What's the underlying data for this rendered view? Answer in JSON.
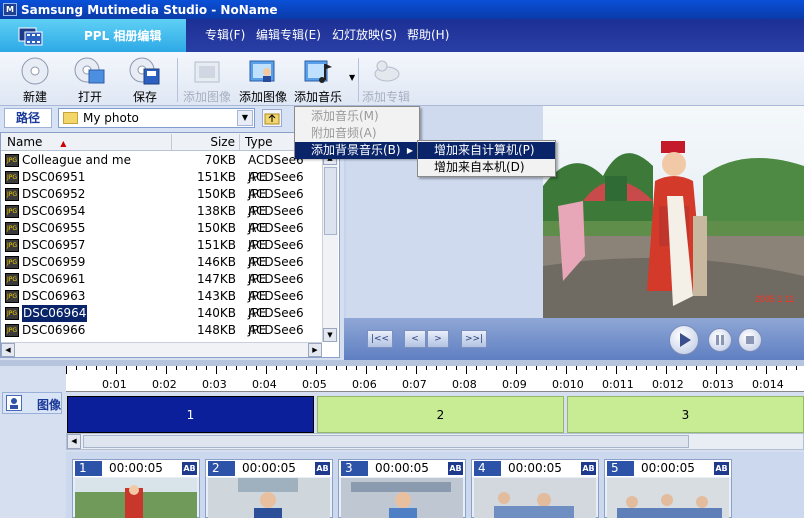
{
  "window": {
    "title": "Samsung Mutimedia Studio - NoName"
  },
  "header": {
    "tab_label": "PPL 相册编辑"
  },
  "menu": [
    {
      "label": "专辑(F)"
    },
    {
      "label": "编辑专辑(E)"
    },
    {
      "label": "幻灯放映(S)"
    },
    {
      "label": "帮助(H)"
    }
  ],
  "toolbar": {
    "new": "新建",
    "open": "打开",
    "save": "保存",
    "add_image_disabled": "添加图像",
    "add_image": "添加图像",
    "add_music": "添加音乐",
    "add_album": "添加专辑"
  },
  "path": {
    "label": "路径",
    "value": "My photo"
  },
  "filelist": {
    "columns": {
      "name": "Name",
      "size": "Size",
      "type": "Type"
    },
    "rows": [
      {
        "name": "Colleague and me",
        "size": "70KB",
        "type": "ACDSee6 JPE"
      },
      {
        "name": "DSC06951",
        "size": "151KB",
        "type": "ACDSee6 JPE"
      },
      {
        "name": "DSC06952",
        "size": "150KB",
        "type": "ACDSee6 JPE"
      },
      {
        "name": "DSC06954",
        "size": "138KB",
        "type": "ACDSee6 JPE"
      },
      {
        "name": "DSC06955",
        "size": "150KB",
        "type": "ACDSee6 JPE"
      },
      {
        "name": "DSC06957",
        "size": "151KB",
        "type": "ACDSee6 JPE"
      },
      {
        "name": "DSC06959",
        "size": "146KB",
        "type": "ACDSee6 JPE"
      },
      {
        "name": "DSC06961",
        "size": "147KB",
        "type": "ACDSee6 JPE"
      },
      {
        "name": "DSC06963",
        "size": "143KB",
        "type": "ACDSee6 JPE"
      },
      {
        "name": "DSC06964",
        "size": "140KB",
        "type": "ACDSee6 JPE"
      },
      {
        "name": "DSC06966",
        "size": "148KB",
        "type": "ACDSee6 JPE"
      }
    ],
    "selected_index": 9
  },
  "context_menu": {
    "items": [
      {
        "label": "添加音乐(M)"
      },
      {
        "label": "附加音频(A)"
      },
      {
        "label": "添加背景音乐(B)"
      }
    ],
    "submenu": [
      {
        "label": "增加来自计算机(P)"
      },
      {
        "label": "增加来自本机(D)"
      }
    ]
  },
  "preview": {
    "photo_stamp": "2005 1 11"
  },
  "controls": {
    "first": "|<<",
    "prev": "<",
    "next": ">",
    "last": ">>|"
  },
  "timeline": {
    "ruler_labels": [
      "0:01",
      "0:02",
      "0:03",
      "0:04",
      "0:05",
      "0:06",
      "0:07",
      "0:08",
      "0:09",
      "0:010",
      "0:011",
      "0:012",
      "0:013",
      "0:014"
    ],
    "track_name": "图像",
    "segments": [
      "1",
      "2",
      "3"
    ]
  },
  "thumbnails": [
    {
      "num": "1",
      "duration": "00:00:05",
      "badge": "AB"
    },
    {
      "num": "2",
      "duration": "00:00:05",
      "badge": "AB"
    },
    {
      "num": "3",
      "duration": "00:00:05",
      "badge": "AB"
    },
    {
      "num": "4",
      "duration": "00:00:05",
      "badge": "AB"
    },
    {
      "num": "5",
      "duration": "00:00:05",
      "badge": "AB"
    }
  ],
  "colors": {
    "titlebar": "#0a3aa8",
    "menuband": "#1c2f95",
    "tab_accent": "#2da9e6",
    "selected_segment": "#0b1f9a",
    "segment": "#c8ec94",
    "selection": "#0a246a"
  }
}
